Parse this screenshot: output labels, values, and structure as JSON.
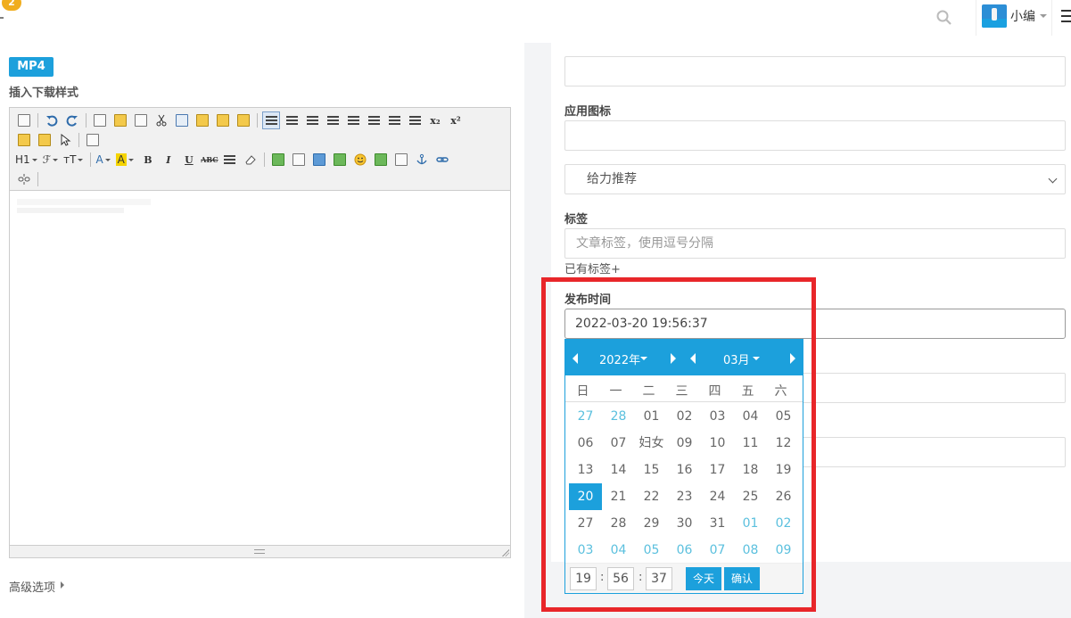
{
  "header": {
    "notification_count": "2",
    "user_name": "小编"
  },
  "left": {
    "mp4_label": "MP4",
    "insert_label": "插入下载样式",
    "toolbar": {
      "heading": "H1",
      "font": "ℱ",
      "font_size": "тT",
      "font_color": "A",
      "bg_color": "A",
      "bold": "B",
      "italic": "I",
      "underline": "U",
      "strike": "ABC",
      "subscript": "x₂",
      "superscript": "x²"
    },
    "advanced_label": "高级选项"
  },
  "right": {
    "app_icon_label": "应用图标",
    "recommend_selected": "给力推荐",
    "tags_label": "标签",
    "tags_placeholder": "文章标签，使用逗号分隔",
    "existing_tags": "已有标签+",
    "publish_label": "发布时间",
    "publish_value": "2022-03-20 19:56:37"
  },
  "datepicker": {
    "year_label": "2022年",
    "month_label": "03月",
    "weekdays": [
      "日",
      "一",
      "二",
      "三",
      "四",
      "五",
      "六"
    ],
    "weeks": [
      [
        "27",
        "28",
        "01",
        "02",
        "03",
        "04",
        "05"
      ],
      [
        "06",
        "07",
        "妇女",
        "09",
        "10",
        "11",
        "12"
      ],
      [
        "13",
        "14",
        "15",
        "16",
        "17",
        "18",
        "19"
      ],
      [
        "20",
        "21",
        "22",
        "23",
        "24",
        "25",
        "26"
      ],
      [
        "27",
        "28",
        "29",
        "30",
        "31",
        "01",
        "02"
      ],
      [
        "03",
        "04",
        "05",
        "06",
        "07",
        "08",
        "09"
      ]
    ],
    "other_month": [
      [
        true,
        true,
        false,
        false,
        false,
        false,
        false
      ],
      [
        false,
        false,
        false,
        false,
        false,
        false,
        false
      ],
      [
        false,
        false,
        false,
        false,
        false,
        false,
        false
      ],
      [
        false,
        false,
        false,
        false,
        false,
        false,
        false
      ],
      [
        false,
        false,
        false,
        false,
        false,
        true,
        true
      ],
      [
        true,
        true,
        true,
        true,
        true,
        true,
        true
      ]
    ],
    "selected_week": 3,
    "selected_day": 0,
    "hour": "19",
    "minute": "56",
    "second": "37",
    "today_label": "今天",
    "confirm_label": "确认"
  },
  "colors": {
    "accent": "#1ca0dc",
    "highlight": "#e8262a",
    "badge": "#f0ad1e"
  }
}
